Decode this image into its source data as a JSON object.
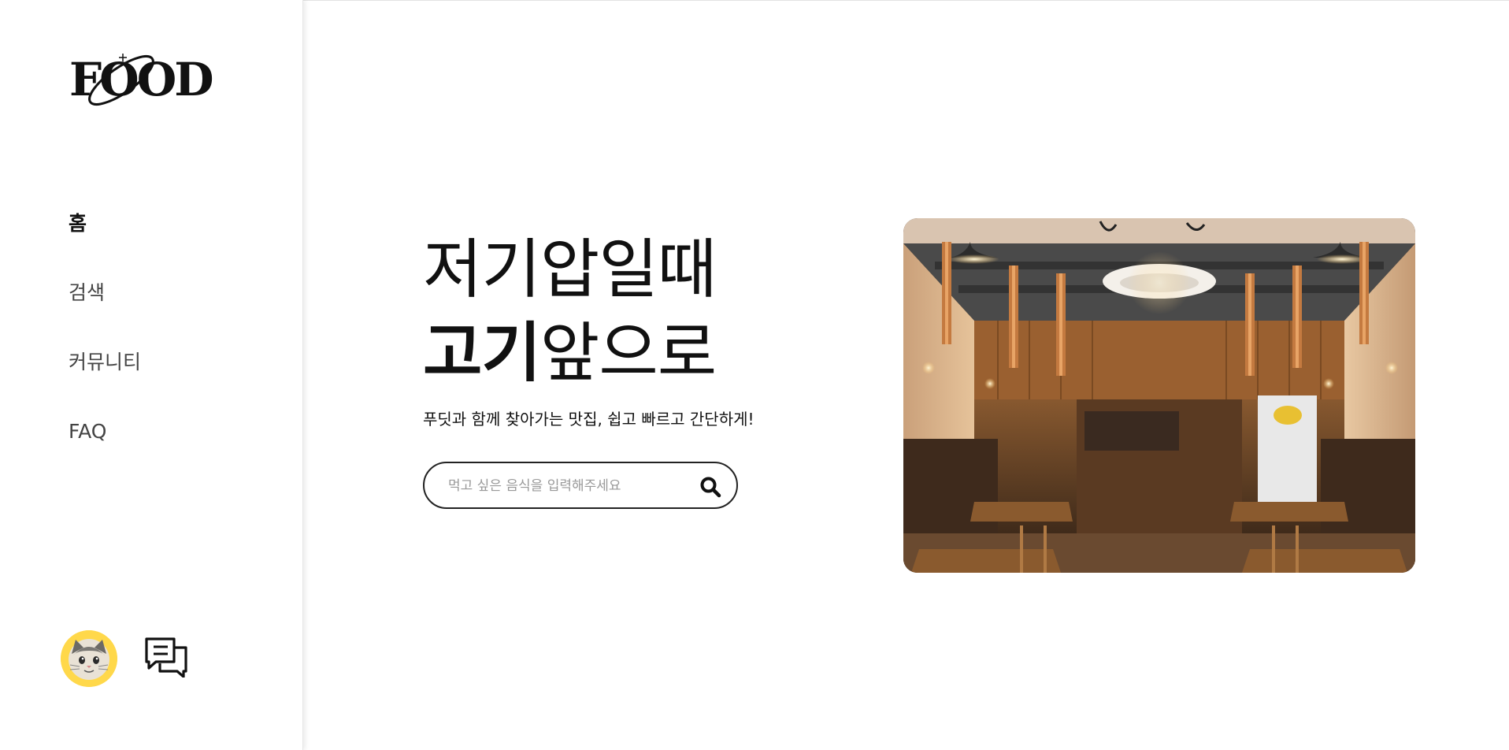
{
  "logo": {
    "text": "FOOD"
  },
  "nav": {
    "items": [
      {
        "label": "홈",
        "active": true
      },
      {
        "label": "검색",
        "active": false
      },
      {
        "label": "커뮤니티",
        "active": false
      },
      {
        "label": "FAQ",
        "active": false
      }
    ]
  },
  "hero": {
    "line1": "저기압일때",
    "line2_bold": "고기",
    "line2_rest": "앞으로",
    "subtitle": "푸딧과 함께 찾아가는 맛집, 쉽고 빠르고 간단하게!"
  },
  "search": {
    "placeholder": "먹고 싶은 음식을 입력해주세요",
    "value": ""
  },
  "icons": {
    "avatar": "cat-avatar-icon",
    "chat": "chat-bubbles-icon",
    "search": "search-icon"
  },
  "colors": {
    "accent": "#ffd84a",
    "text": "#111111",
    "border": "#222222"
  }
}
